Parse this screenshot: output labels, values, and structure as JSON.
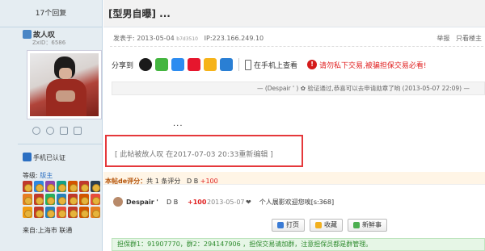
{
  "left": {
    "reply_count": "17个回复",
    "username": "故人叹",
    "uid": "ZxID：6586",
    "phone_verified": "手机已认证",
    "level_label": "等级:",
    "level_value": "版主",
    "location": "来自:上海市 联通"
  },
  "header": {
    "title": "[型男自曝] ..."
  },
  "meta": {
    "posted": "发表于: 2013-05-04",
    "hash": "b7d3510",
    "ip": "IP:223.166.249.10",
    "report": "举报",
    "only_author": "只看楼主"
  },
  "share": {
    "label": "分享到",
    "phone_view": "在手机上查看",
    "warning": "请勿私下交易,被骗担保交易必看!"
  },
  "rate_banner": "— (Despair ' ) ✿ 验证通过,恭喜可以去申请勋章了哟 (2013-05-07 22:09) —",
  "body": {
    "ellipsis": "...",
    "edit_notice": "[ 此帖被故人叹 在2017-07-03 20:33重新编辑 ]"
  },
  "rating": {
    "label": "本帖de评分：",
    "summary": "共 1 条评分",
    "db": "D B",
    "points": "+100"
  },
  "rater": {
    "name": "Despair '",
    "db": "D B",
    "points": "+100",
    "date": "2013-05-07",
    "heart": "❤",
    "comment": "个人展影欢迎您唉[s:368]"
  },
  "actions": {
    "print": "打页",
    "favorite": "收藏",
    "fresh": "新鲜事"
  },
  "guarantee": "担保群1：91907770，群2：294147906 ，担保交易请加群，注意担保员都是群管理。"
}
